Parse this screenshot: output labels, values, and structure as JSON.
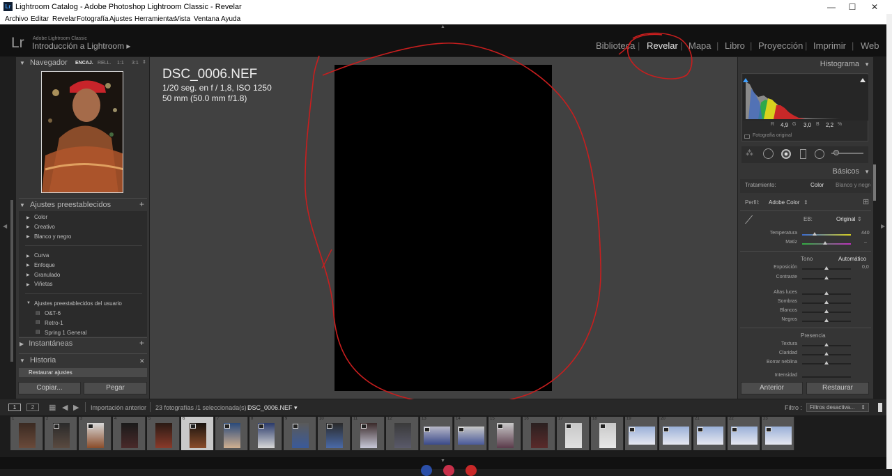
{
  "window": {
    "title": "Lightroom Catalog - Adobe Photoshop Lightroom Classic - Revelar"
  },
  "menu": [
    "Archivo",
    "Editar",
    "Revelar",
    "Fotografía",
    "Ajustes",
    "Herramientas",
    "Vista",
    "Ventana",
    "Ayuda"
  ],
  "identity": {
    "logo": "Lr",
    "small": "Adobe Lightroom Classic",
    "title": "Introducción a Lightroom ▸"
  },
  "modules": [
    "Biblioteca",
    "Revelar",
    "Mapa",
    "Libro",
    "Proyección",
    "Imprimir",
    "Web"
  ],
  "active_module": "Revelar",
  "navigator": {
    "title": "Navegador",
    "zoom": [
      "ENCAJ.",
      "RELL.",
      "1:1",
      "3:1"
    ]
  },
  "presets": {
    "title": "Ajustes preestablecidos",
    "add": "+",
    "group1": [
      "Color",
      "Creativo",
      "Blanco y negro"
    ],
    "group2": [
      "Curva",
      "Enfoque",
      "Granulado",
      "Viñetas"
    ],
    "user_group": "Ajustes preestablecidos del usuario",
    "user_items": [
      "O&T-6",
      "Retro-1",
      "Spring 1 General"
    ]
  },
  "snapshots": {
    "title": "Instantáneas",
    "add": "+"
  },
  "history": {
    "title": "Historia",
    "close": "✕",
    "items": [
      "Restaurar ajustes"
    ]
  },
  "left_buttons": {
    "copy": "Copiar...",
    "paste": "Pegar"
  },
  "photo_info": {
    "filename": "DSC_0006.NEF",
    "exposure": "1/20 seg. en f / 1,8, ISO 1250",
    "lens": "50 mm (50.0 mm f/1.8)"
  },
  "histogram": {
    "title": "Histograma",
    "r_label": "R",
    "r_value": "4,9",
    "g_label": "G",
    "g_value": "3,0",
    "b_label": "B",
    "b_value": "2,2",
    "unit": "%",
    "original_label": "Fotografía original"
  },
  "basics": {
    "title": "Básicos",
    "treatment_label": "Tratamiento:",
    "treatment_color": "Color",
    "treatment_bw": "Blanco y negro",
    "profile_label": "Perfil:",
    "profile_value": "Adobe Color",
    "wb_label": "EB:",
    "wb_value": "Original",
    "temp_label": "Temperatura",
    "temp_value": "440",
    "tint_label": "Matiz",
    "tint_value": "–",
    "tone_label": "Tono",
    "auto": "Automático",
    "exposure_label": "Exposición",
    "exposure_value": "0,0",
    "contrast_label": "Contraste",
    "highlights_label": "Altas luces",
    "shadows_label": "Sombras",
    "whites_label": "Blancos",
    "blacks_label": "Negros",
    "presence_label": "Presencia",
    "texture_label": "Textura",
    "clarity_label": "Claridad",
    "dehaze_label": "Borrar neblina",
    "vibrance_label": "Intensidad"
  },
  "right_buttons": {
    "previous": "Anterior",
    "reset": "Restaurar"
  },
  "filmstrip_bar": {
    "page1": "1",
    "page2": "2",
    "source": "Importación anterior",
    "count": "23 fotografías /1 seleccionada(s) /",
    "selected_file": "DSC_0006.NEF ▾",
    "filter_label": "Filtro :",
    "filter_value": "Filtros desactiva..."
  },
  "filmstrip_numbers": [
    "1",
    "2",
    "3",
    "4",
    "5",
    "6",
    "7",
    "8",
    "9",
    "10",
    "11",
    "12",
    "13",
    "14",
    "15",
    "16",
    "17",
    "18",
    "19",
    "20",
    "21",
    "22",
    "23"
  ],
  "colors": {
    "accent_red": "#c81e1e",
    "panel": "#353535",
    "center": "#414141"
  }
}
